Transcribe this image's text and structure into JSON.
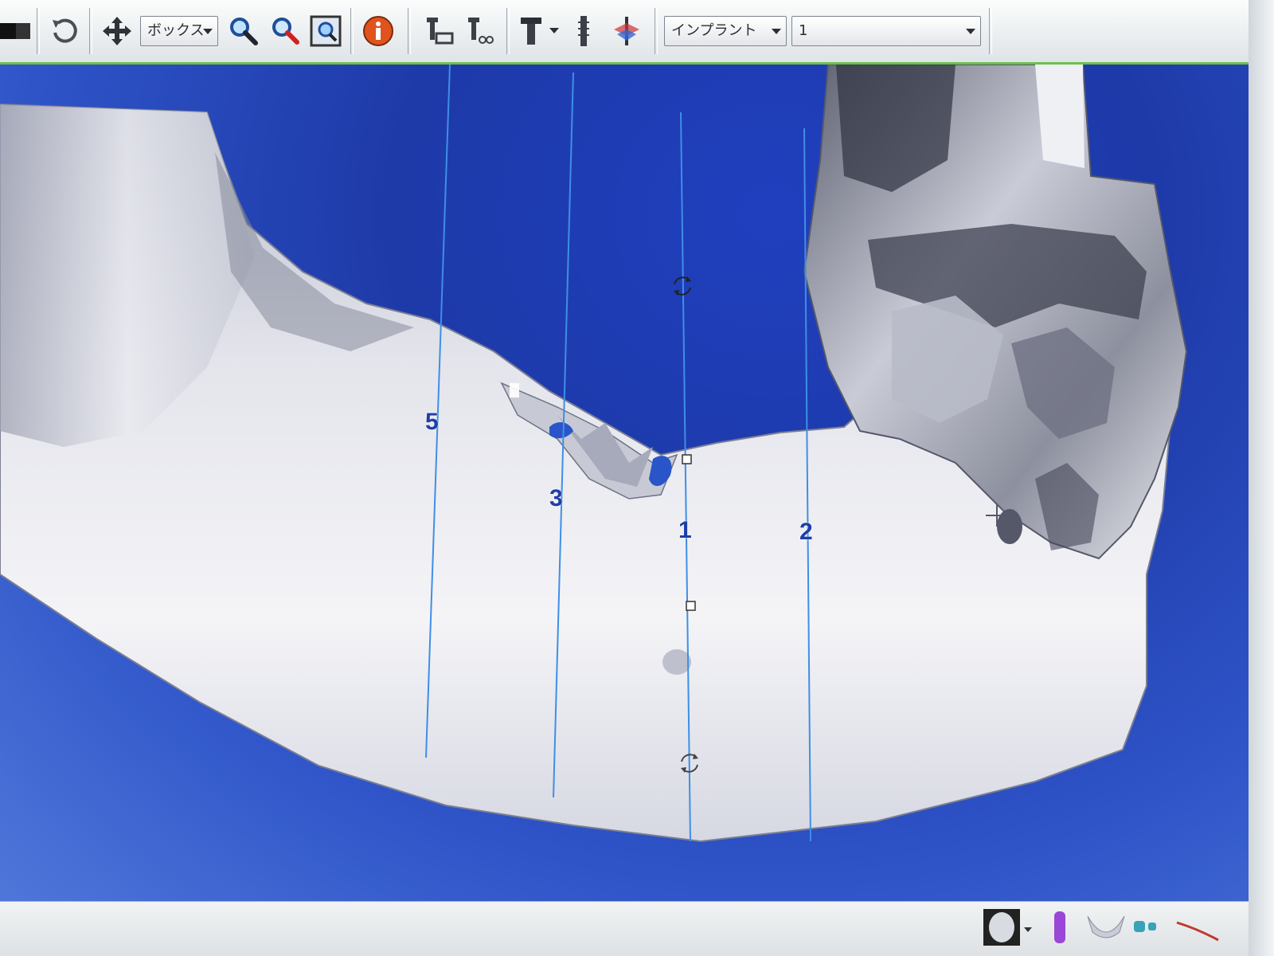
{
  "toolbar": {
    "view_mode": "ボックス",
    "object_type": "インプラント",
    "implant_number": "1",
    "icons": [
      "grayscale-bar-icon",
      "rotate-icon",
      "pan-move-icon",
      "zoom-in-icon",
      "zoom-region-icon",
      "fit-view-icon",
      "info-icon",
      "implant-place-icon",
      "implant-list-icon",
      "implant-single-icon",
      "implant-axis-icon",
      "implant-compare-icon"
    ]
  },
  "viewport": {
    "slice_labels": [
      "5",
      "3",
      "1",
      "2"
    ],
    "colors": {
      "background": "#2443b6",
      "bone": "#e8e9ef",
      "slice_line": "#3e8fe6",
      "implant": "#2a55c8"
    }
  },
  "statusbar": {
    "icons": [
      "skull-thumbnail-icon",
      "implant-color-icon",
      "mandible-thumbnail-icon",
      "teeth-icon",
      "nerve-line-icon"
    ]
  }
}
